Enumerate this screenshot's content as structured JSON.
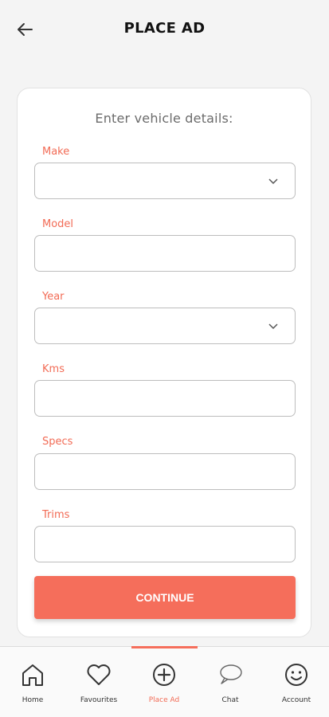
{
  "header": {
    "title": "PLACE AD",
    "back_icon": "arrow-left-icon"
  },
  "form": {
    "heading": "Enter vehicle details:",
    "fields": [
      {
        "label": "Make",
        "value": "",
        "type": "dropdown"
      },
      {
        "label": "Model",
        "value": "",
        "type": "text"
      },
      {
        "label": "Year",
        "value": "",
        "type": "dropdown"
      },
      {
        "label": "Kms",
        "value": "",
        "type": "text"
      },
      {
        "label": "Specs",
        "value": "",
        "type": "text"
      },
      {
        "label": "Trims",
        "value": "",
        "type": "text"
      }
    ],
    "continue_label": "CONTINUE"
  },
  "nav": {
    "items": [
      {
        "label": "Home",
        "icon": "home-icon"
      },
      {
        "label": "Favourites",
        "icon": "heart-icon"
      },
      {
        "label": "Place Ad",
        "icon": "plus-circle-icon",
        "active": true
      },
      {
        "label": "Chat",
        "icon": "chat-bubble-icon"
      },
      {
        "label": "Account",
        "icon": "smiley-icon"
      }
    ]
  },
  "colors": {
    "accent": "#f56e5b",
    "label": "#f26b55",
    "background": "#f4f4f4"
  }
}
